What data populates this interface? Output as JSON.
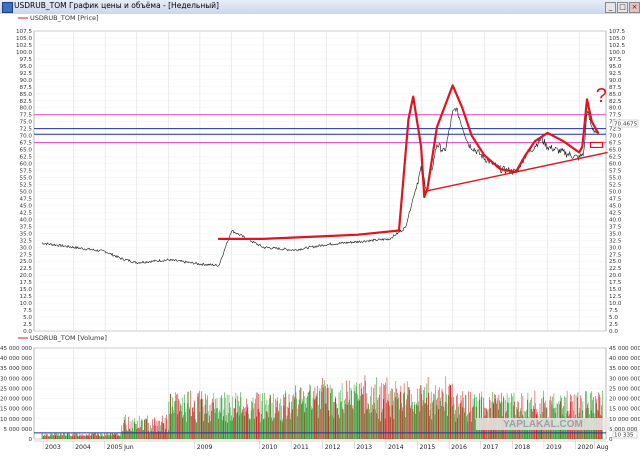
{
  "window": {
    "title": "USDRUB_TOM График цены и объёма - [Недельный]",
    "icon": "chart-window-icon",
    "controls": [
      "minimize",
      "maximize",
      "close"
    ]
  },
  "price_panel": {
    "legend_label": "USDRUB_TOM [Price]",
    "current_value_label": "70.4675",
    "colors": {
      "price_line": "#000000",
      "annotation": "#e0141e",
      "magenta_level": "#e040c8",
      "blue_level": "#1f2fa8"
    }
  },
  "volume_panel": {
    "legend_label": "USDRUB_TOM [Volume]",
    "current_value_label": "10 335",
    "watermark": "YAPLAKAL.COM",
    "colors": {
      "up": "#2ea02e",
      "down": "#d02020",
      "baseline": "#1f2fa8"
    }
  },
  "chart_data": [
    {
      "type": "line",
      "title": "USDRUB_TOM [Price]",
      "ylabel": "",
      "ylim": [
        0,
        107.5
      ],
      "y_ticks": [
        "0.0",
        "2.5",
        "5.0",
        "7.5",
        "10.0",
        "12.5",
        "15.0",
        "17.5",
        "20.0",
        "22.5",
        "25.0",
        "27.5",
        "30.0",
        "32.5",
        "35.0",
        "37.5",
        "40.0",
        "42.5",
        "45.0",
        "47.5",
        "50.0",
        "52.5",
        "55.0",
        "57.5",
        "60.0",
        "62.5",
        "65.0",
        "67.5",
        "70.0",
        "72.5",
        "75.0",
        "77.5",
        "80.0",
        "82.5",
        "85.0",
        "87.5",
        "90.0",
        "92.5",
        "95.0",
        "97.5",
        "100.0",
        "102.5",
        "105.0",
        "107.5"
      ],
      "grid": true,
      "x": [
        2003,
        2004,
        2005,
        2005.5,
        2006,
        2007,
        2008,
        2008.6,
        2009,
        2010,
        2011,
        2012,
        2013,
        2014,
        2014.5,
        2014.85,
        2015,
        2015.2,
        2015.5,
        2015.75,
        2016,
        2016.1,
        2016.5,
        2017,
        2017.5,
        2018,
        2018.3,
        2018.5,
        2018.8,
        2019,
        2019.5,
        2020,
        2020.15,
        2020.25,
        2020.4,
        2020.6
      ],
      "series": [
        {
          "values": [
            31.5,
            30,
            28.5,
            26,
            24.5,
            25.5,
            24,
            23.5,
            36,
            30,
            29,
            31,
            32,
            33,
            37,
            52,
            58,
            50,
            67,
            64,
            78,
            80,
            67,
            62,
            58,
            57,
            63,
            65,
            69,
            66,
            64,
            62,
            64,
            79,
            73,
            70.5
          ]
        }
      ],
      "levels": [
        {
          "y": 77.5,
          "color": "#e040c8"
        },
        {
          "y": 72.5,
          "color": "#1f2fa8"
        },
        {
          "y": 70.5,
          "color": "#1f2fa8"
        },
        {
          "y": 67.5,
          "color": "#e040c8"
        }
      ],
      "annotations": [
        {
          "kind": "freehand",
          "x": [
            2008.6,
            2010,
            2012,
            2013,
            2014.3,
            2014.6,
            2014.75,
            2015,
            2015.1,
            2015.2,
            2015.5,
            2016,
            2016.3,
            2016.6,
            2017,
            2017.5,
            2018,
            2018.3,
            2018.6,
            2019,
            2019.5,
            2020,
            2020.1,
            2020.25,
            2020.4,
            2020.6
          ],
          "y": [
            33,
            33,
            34,
            34.5,
            36,
            76,
            84,
            66,
            48,
            51,
            73,
            88,
            80,
            70,
            63,
            58,
            57,
            63,
            68,
            71,
            68,
            64,
            66,
            83,
            75,
            71
          ]
        },
        {
          "kind": "trendline",
          "x": [
            2015.1,
            2020.9
          ],
          "y": [
            50,
            64
          ]
        },
        {
          "kind": "question_mark",
          "x": 2020.7,
          "y": 82
        },
        {
          "kind": "box",
          "x": 2020.55,
          "y": 66.5
        }
      ]
    },
    {
      "type": "bar",
      "title": "USDRUB_TOM [Volume]",
      "ylim": [
        0,
        45000000
      ],
      "y_ticks": [
        "0",
        "5 000 000",
        "10 000 000",
        "15 000 000",
        "20 000 000",
        "25 000 000",
        "30 000 000",
        "35 000 000",
        "40 000 000",
        "45 000 000"
      ],
      "x_ticks": [
        "2003",
        "2004",
        "2005",
        "Jun",
        "2009",
        "2010",
        "2011",
        "2012",
        "2013",
        "2014",
        "2015",
        "2016",
        "2017",
        "2018",
        "2019",
        "2020",
        "Aug"
      ],
      "grid": true,
      "baseline_level": 3000000
    }
  ]
}
